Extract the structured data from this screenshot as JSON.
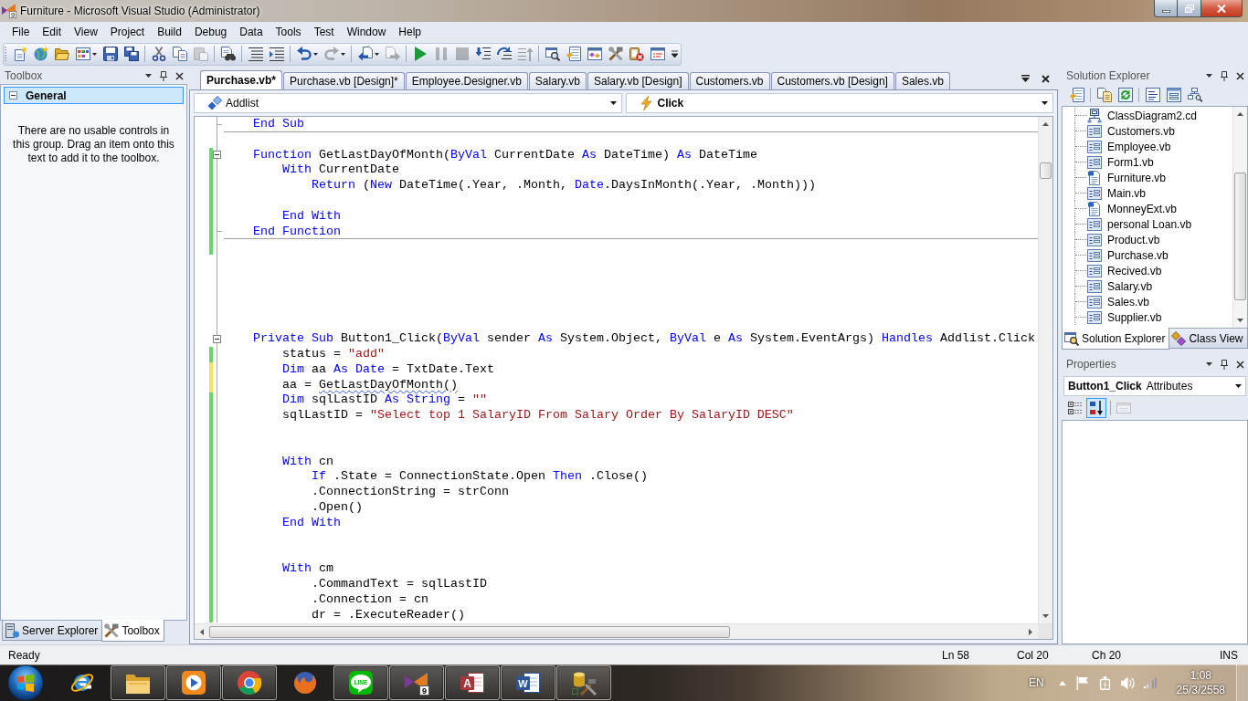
{
  "window": {
    "title": "Furniture - Microsoft Visual Studio (Administrator)",
    "icon_badge": "9"
  },
  "menu": [
    "File",
    "Edit",
    "View",
    "Project",
    "Build",
    "Debug",
    "Data",
    "Tools",
    "Test",
    "Window",
    "Help"
  ],
  "toolbar": [
    [
      {
        "kind": "new-project",
        "dropdown": false,
        "disabled": false
      },
      {
        "kind": "new-website",
        "dropdown": false,
        "disabled": false
      },
      {
        "kind": "open-file",
        "dropdown": false,
        "disabled": false
      },
      {
        "kind": "add-item",
        "dropdown": true,
        "disabled": false
      },
      {
        "kind": "save",
        "dropdown": false,
        "disabled": false
      },
      {
        "kind": "save-all",
        "dropdown": false,
        "disabled": false
      }
    ],
    [
      {
        "kind": "cut",
        "dropdown": false,
        "disabled": false
      },
      {
        "kind": "copy",
        "dropdown": false,
        "disabled": false
      },
      {
        "kind": "paste",
        "dropdown": false,
        "disabled": true
      }
    ],
    [
      {
        "kind": "find-in-files",
        "dropdown": false,
        "disabled": false
      }
    ],
    [
      {
        "kind": "comment",
        "dropdown": false,
        "disabled": false
      },
      {
        "kind": "uncomment",
        "dropdown": false,
        "disabled": false
      }
    ],
    [
      {
        "kind": "undo",
        "dropdown": true,
        "disabled": false
      },
      {
        "kind": "redo",
        "dropdown": true,
        "disabled": true
      }
    ],
    [
      {
        "kind": "navigate-back",
        "dropdown": true,
        "disabled": false
      },
      {
        "kind": "navigate-forward",
        "dropdown": false,
        "disabled": true
      }
    ],
    [
      {
        "kind": "start",
        "dropdown": false,
        "disabled": false
      },
      {
        "kind": "pause",
        "dropdown": false,
        "disabled": true
      },
      {
        "kind": "stop",
        "dropdown": false,
        "disabled": true
      },
      {
        "kind": "step-into",
        "dropdown": false,
        "disabled": false
      },
      {
        "kind": "step-over",
        "dropdown": false,
        "disabled": false
      },
      {
        "kind": "step-out",
        "dropdown": false,
        "disabled": true
      }
    ],
    [
      {
        "kind": "find-symbol",
        "dropdown": false,
        "disabled": false
      },
      {
        "kind": "properties",
        "dropdown": false,
        "disabled": false
      },
      {
        "kind": "object-browser",
        "dropdown": false,
        "disabled": false
      },
      {
        "kind": "toolbox",
        "dropdown": false,
        "disabled": false
      },
      {
        "kind": "error-list",
        "dropdown": false,
        "disabled": false
      },
      {
        "kind": "command-window",
        "dropdown": false,
        "disabled": false
      }
    ]
  ],
  "toolbox": {
    "title": "Toolbox",
    "group": {
      "label": "General",
      "expanded": true,
      "selected": true
    },
    "message": "There are no usable controls in this group. Drag an item onto this text to add it to the toolbox.",
    "tabs": [
      {
        "label": "Server Explorer",
        "kind": "server",
        "selected": false
      },
      {
        "label": "Toolbox",
        "kind": "toolbox",
        "selected": true
      }
    ]
  },
  "editor": {
    "tabs": [
      {
        "label": "Purchase.vb*",
        "selected": true
      },
      {
        "label": "Purchase.vb [Design]*",
        "selected": false
      },
      {
        "label": "Employee.Designer.vb",
        "selected": false
      },
      {
        "label": "Salary.vb",
        "selected": false
      },
      {
        "label": "Salary.vb [Design]",
        "selected": false
      },
      {
        "label": "Customers.vb",
        "selected": false
      },
      {
        "label": "Customers.vb [Design]",
        "selected": false
      },
      {
        "label": "Sales.vb",
        "selected": false
      }
    ],
    "type_dropdown": "Addlist",
    "member_dropdown": "Click",
    "lines": [
      {
        "saved_change": false,
        "unsaved_change": false,
        "fold_start": false,
        "fold_end": true,
        "separator": true,
        "tokens": [
          {
            "kind": "keyword",
            "text": "    End Sub"
          }
        ]
      },
      {
        "saved_change": false,
        "unsaved_change": false,
        "fold_start": false,
        "fold_end": false,
        "separator": false
      },
      {
        "saved_change": true,
        "unsaved_change": false,
        "fold_start": true,
        "fold_end": false,
        "separator": false,
        "tokens": [
          {
            "kind": "keyword",
            "text": "    Function"
          },
          {
            "kind": "plain",
            "text": " GetLastDayOfMonth("
          },
          {
            "kind": "keyword",
            "text": "ByVal"
          },
          {
            "kind": "plain",
            "text": " CurrentDate "
          },
          {
            "kind": "keyword",
            "text": "As"
          },
          {
            "kind": "plain",
            "text": " DateTime) "
          },
          {
            "kind": "keyword",
            "text": "As"
          },
          {
            "kind": "plain",
            "text": " DateTime"
          }
        ]
      },
      {
        "saved_change": true,
        "unsaved_change": false,
        "fold_start": false,
        "fold_end": false,
        "separator": false,
        "tokens": [
          {
            "kind": "keyword",
            "text": "        With"
          },
          {
            "kind": "plain",
            "text": " CurrentDate"
          }
        ]
      },
      {
        "saved_change": true,
        "unsaved_change": false,
        "fold_start": false,
        "fold_end": false,
        "separator": false,
        "tokens": [
          {
            "kind": "keyword",
            "text": "            Return"
          },
          {
            "kind": "plain",
            "text": " ("
          },
          {
            "kind": "keyword",
            "text": "New"
          },
          {
            "kind": "plain",
            "text": " DateTime(.Year, .Month, "
          },
          {
            "kind": "keyword",
            "text": "Date"
          },
          {
            "kind": "plain",
            "text": ".DaysInMonth(.Year, .Month)))"
          }
        ]
      },
      {
        "saved_change": true,
        "unsaved_change": false,
        "fold_start": false,
        "fold_end": false,
        "separator": false
      },
      {
        "saved_change": true,
        "unsaved_change": false,
        "fold_start": false,
        "fold_end": false,
        "separator": false,
        "tokens": [
          {
            "kind": "keyword",
            "text": "        End With"
          }
        ]
      },
      {
        "saved_change": true,
        "unsaved_change": false,
        "fold_start": false,
        "fold_end": true,
        "separator": true,
        "tokens": [
          {
            "kind": "keyword",
            "text": "    End Function"
          }
        ]
      },
      {
        "saved_change": true,
        "unsaved_change": false,
        "fold_start": false,
        "fold_end": false,
        "separator": false
      },
      {
        "saved_change": false,
        "unsaved_change": false,
        "fold_start": false,
        "fold_end": false,
        "separator": false
      },
      {
        "saved_change": false,
        "unsaved_change": false,
        "fold_start": false,
        "fold_end": false,
        "separator": false
      },
      {
        "saved_change": false,
        "unsaved_change": false,
        "fold_start": false,
        "fold_end": false,
        "separator": false
      },
      {
        "saved_change": false,
        "unsaved_change": false,
        "fold_start": false,
        "fold_end": false,
        "separator": false
      },
      {
        "saved_change": false,
        "unsaved_change": false,
        "fold_start": false,
        "fold_end": false,
        "separator": false
      },
      {
        "saved_change": false,
        "unsaved_change": false,
        "fold_start": true,
        "fold_end": false,
        "separator": false,
        "tokens": [
          {
            "kind": "keyword",
            "text": "    Private Sub"
          },
          {
            "kind": "plain",
            "text": " Button1_Click("
          },
          {
            "kind": "keyword",
            "text": "ByVal"
          },
          {
            "kind": "plain",
            "text": " sender "
          },
          {
            "kind": "keyword",
            "text": "As"
          },
          {
            "kind": "plain",
            "text": " System.Object, "
          },
          {
            "kind": "keyword",
            "text": "ByVal"
          },
          {
            "kind": "plain",
            "text": " e "
          },
          {
            "kind": "keyword",
            "text": "As"
          },
          {
            "kind": "plain",
            "text": " System.EventArgs) "
          },
          {
            "kind": "keyword",
            "text": "Handles"
          },
          {
            "kind": "plain",
            "text": " Addlist.Click"
          }
        ]
      },
      {
        "saved_change": true,
        "unsaved_change": false,
        "fold_start": false,
        "fold_end": false,
        "separator": false,
        "tokens": [
          {
            "kind": "plain",
            "text": "        status = "
          },
          {
            "kind": "string",
            "text": "\"add\""
          }
        ]
      },
      {
        "saved_change": false,
        "unsaved_change": true,
        "fold_start": false,
        "fold_end": false,
        "separator": false,
        "tokens": [
          {
            "kind": "keyword",
            "text": "        Dim"
          },
          {
            "kind": "plain",
            "text": " aa "
          },
          {
            "kind": "keyword",
            "text": "As Date"
          },
          {
            "kind": "plain",
            "text": " = TxtDate.Text"
          }
        ]
      },
      {
        "saved_change": false,
        "unsaved_change": true,
        "fold_start": false,
        "fold_end": false,
        "separator": false,
        "tokens": [
          {
            "kind": "plain",
            "text": "        aa = "
          },
          {
            "kind": "error",
            "text": "GetLastDayOfMonth()"
          }
        ]
      },
      {
        "saved_change": true,
        "unsaved_change": false,
        "fold_start": false,
        "fold_end": false,
        "separator": false,
        "tokens": [
          {
            "kind": "keyword",
            "text": "        Dim"
          },
          {
            "kind": "plain",
            "text": " sqlLastID "
          },
          {
            "kind": "keyword",
            "text": "As String"
          },
          {
            "kind": "plain",
            "text": " = "
          },
          {
            "kind": "string",
            "text": "\"\""
          }
        ]
      },
      {
        "saved_change": true,
        "unsaved_change": false,
        "fold_start": false,
        "fold_end": false,
        "separator": false,
        "tokens": [
          {
            "kind": "plain",
            "text": "        sqlLastID = "
          },
          {
            "kind": "string",
            "text": "\"Select top 1 SalaryID From Salary Order By SalaryID DESC\""
          }
        ]
      },
      {
        "saved_change": true,
        "unsaved_change": false,
        "fold_start": false,
        "fold_end": false,
        "separator": false
      },
      {
        "saved_change": true,
        "unsaved_change": false,
        "fold_start": false,
        "fold_end": false,
        "separator": false
      },
      {
        "saved_change": true,
        "unsaved_change": false,
        "fold_start": false,
        "fold_end": false,
        "separator": false,
        "tokens": [
          {
            "kind": "keyword",
            "text": "        With"
          },
          {
            "kind": "plain",
            "text": " cn"
          }
        ]
      },
      {
        "saved_change": true,
        "unsaved_change": false,
        "fold_start": false,
        "fold_end": false,
        "separator": false,
        "tokens": [
          {
            "kind": "keyword",
            "text": "            If"
          },
          {
            "kind": "plain",
            "text": " .State = ConnectionState.Open "
          },
          {
            "kind": "keyword",
            "text": "Then"
          },
          {
            "kind": "plain",
            "text": " .Close()"
          }
        ]
      },
      {
        "saved_change": true,
        "unsaved_change": false,
        "fold_start": false,
        "fold_end": false,
        "separator": false,
        "tokens": [
          {
            "kind": "plain",
            "text": "            .ConnectionString = strConn"
          }
        ]
      },
      {
        "saved_change": true,
        "unsaved_change": false,
        "fold_start": false,
        "fold_end": false,
        "separator": false,
        "tokens": [
          {
            "kind": "plain",
            "text": "            .Open()"
          }
        ]
      },
      {
        "saved_change": true,
        "unsaved_change": false,
        "fold_start": false,
        "fold_end": false,
        "separator": false,
        "tokens": [
          {
            "kind": "keyword",
            "text": "        End With"
          }
        ]
      },
      {
        "saved_change": true,
        "unsaved_change": false,
        "fold_start": false,
        "fold_end": false,
        "separator": false
      },
      {
        "saved_change": true,
        "unsaved_change": false,
        "fold_start": false,
        "fold_end": false,
        "separator": false
      },
      {
        "saved_change": true,
        "unsaved_change": false,
        "fold_start": false,
        "fold_end": false,
        "separator": false,
        "tokens": [
          {
            "kind": "keyword",
            "text": "        With"
          },
          {
            "kind": "plain",
            "text": " cm"
          }
        ]
      },
      {
        "saved_change": true,
        "unsaved_change": false,
        "fold_start": false,
        "fold_end": false,
        "separator": false,
        "tokens": [
          {
            "kind": "plain",
            "text": "            .CommandText = sqlLastID"
          }
        ]
      },
      {
        "saved_change": true,
        "unsaved_change": false,
        "fold_start": false,
        "fold_end": false,
        "separator": false,
        "tokens": [
          {
            "kind": "plain",
            "text": "            .Connection = cn"
          }
        ]
      },
      {
        "saved_change": true,
        "unsaved_change": false,
        "fold_start": false,
        "fold_end": false,
        "separator": false,
        "tokens": [
          {
            "kind": "plain",
            "text": "            dr = .ExecuteReader()"
          }
        ]
      }
    ]
  },
  "solution_explorer": {
    "title": "Solution Explorer",
    "tools": [
      [
        {
          "kind": "properties"
        }
      ],
      [
        {
          "kind": "show-all-files"
        },
        {
          "kind": "refresh"
        }
      ],
      [
        {
          "kind": "view-code"
        },
        {
          "kind": "view-designer"
        },
        {
          "kind": "view-class-diagram"
        }
      ]
    ],
    "items": [
      {
        "label": "ClassDiagram2.cd",
        "kind": "class-diagram"
      },
      {
        "label": "Customers.vb",
        "kind": "form"
      },
      {
        "label": "Employee.vb",
        "kind": "form"
      },
      {
        "label": "Form1.vb",
        "kind": "form"
      },
      {
        "label": "Furniture.vb",
        "kind": "module"
      },
      {
        "label": "Main.vb",
        "kind": "form"
      },
      {
        "label": "MonneyExt.vb",
        "kind": "module"
      },
      {
        "label": "personal Loan.vb",
        "kind": "form"
      },
      {
        "label": "Product.vb",
        "kind": "form"
      },
      {
        "label": "Purchase.vb",
        "kind": "form"
      },
      {
        "label": "Recived.vb",
        "kind": "form"
      },
      {
        "label": "Salary.vb",
        "kind": "form"
      },
      {
        "label": "Sales.vb",
        "kind": "form"
      },
      {
        "label": "Supplier.vb",
        "kind": "form"
      }
    ],
    "tabs": [
      {
        "label": "Solution Explorer",
        "kind": "solution",
        "selected": true
      },
      {
        "label": "Class View",
        "kind": "class-view",
        "selected": false
      }
    ]
  },
  "properties": {
    "title": "Properties",
    "object": {
      "name": "Button1_Click",
      "type": "Attributes"
    },
    "tools": [
      {
        "kind": "categorized",
        "selected": false,
        "disabled": false
      },
      {
        "kind": "alphabetical",
        "selected": true,
        "disabled": false
      },
      {
        "kind": "property-pages",
        "selected": false,
        "disabled": true
      }
    ]
  },
  "status_bar": {
    "message": "Ready",
    "line": "Ln 58",
    "column": "Col 20",
    "char": "Ch 20",
    "mode": "INS"
  },
  "taskbar": {
    "apps": [
      {
        "kind": "ie",
        "running": false
      },
      {
        "kind": "explorer",
        "running": true
      },
      {
        "kind": "media",
        "running": true
      },
      {
        "kind": "chrome",
        "running": true
      },
      {
        "kind": "firefox",
        "running": false
      },
      {
        "kind": "line",
        "running": true,
        "logo_text": "LINE"
      },
      {
        "kind": "vs",
        "running": true,
        "logo_text": "9"
      },
      {
        "kind": "access",
        "running": true,
        "logo_text": "A"
      },
      {
        "kind": "word",
        "running": true,
        "logo_text": "W"
      },
      {
        "kind": "sql-tool",
        "running": true
      }
    ],
    "tray": {
      "language": "EN",
      "time": "1:08",
      "date": "25/3/2558"
    }
  }
}
